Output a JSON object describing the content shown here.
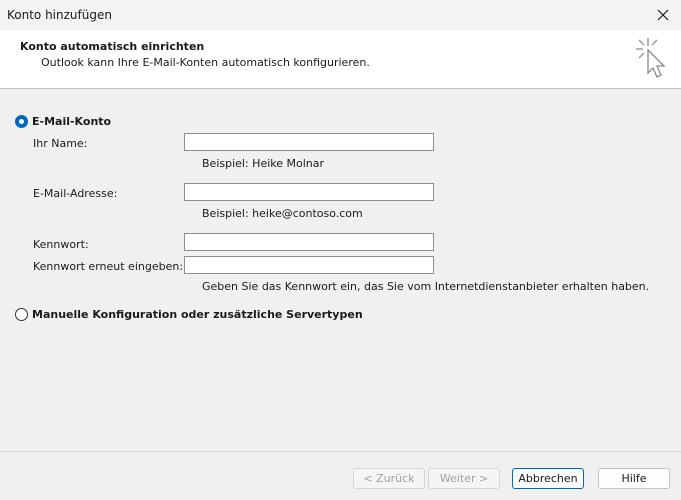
{
  "window": {
    "title": "Konto hinzufügen",
    "close_icon": "close-icon"
  },
  "header": {
    "title": "Konto automatisch einrichten",
    "subtitle": "Outlook kann Ihre E-Mail-Konten automatisch konfigurieren.",
    "icon": "sparkle-cursor-icon"
  },
  "email_account": {
    "option_label": "E-Mail-Konto",
    "selected": true,
    "name_label": "Ihr Name:",
    "name_value": "",
    "name_hint": "Beispiel: Heike Molnar",
    "email_label": "E-Mail-Adresse:",
    "email_value": "",
    "email_hint": "Beispiel: heike@contoso.com",
    "password_label": "Kennwort:",
    "password_value": "",
    "password_repeat_label": "Kennwort erneut eingeben:",
    "password_repeat_value": "",
    "password_hint": "Geben Sie das Kennwort ein, das Sie vom Internetdienstanbieter erhalten haben."
  },
  "manual_config": {
    "option_label": "Manuelle Konfiguration oder zusätzliche Servertypen",
    "selected": false
  },
  "buttons": {
    "back": "< Zurück",
    "next": "Weiter >",
    "cancel": "Abbrechen",
    "help": "Hilfe"
  }
}
